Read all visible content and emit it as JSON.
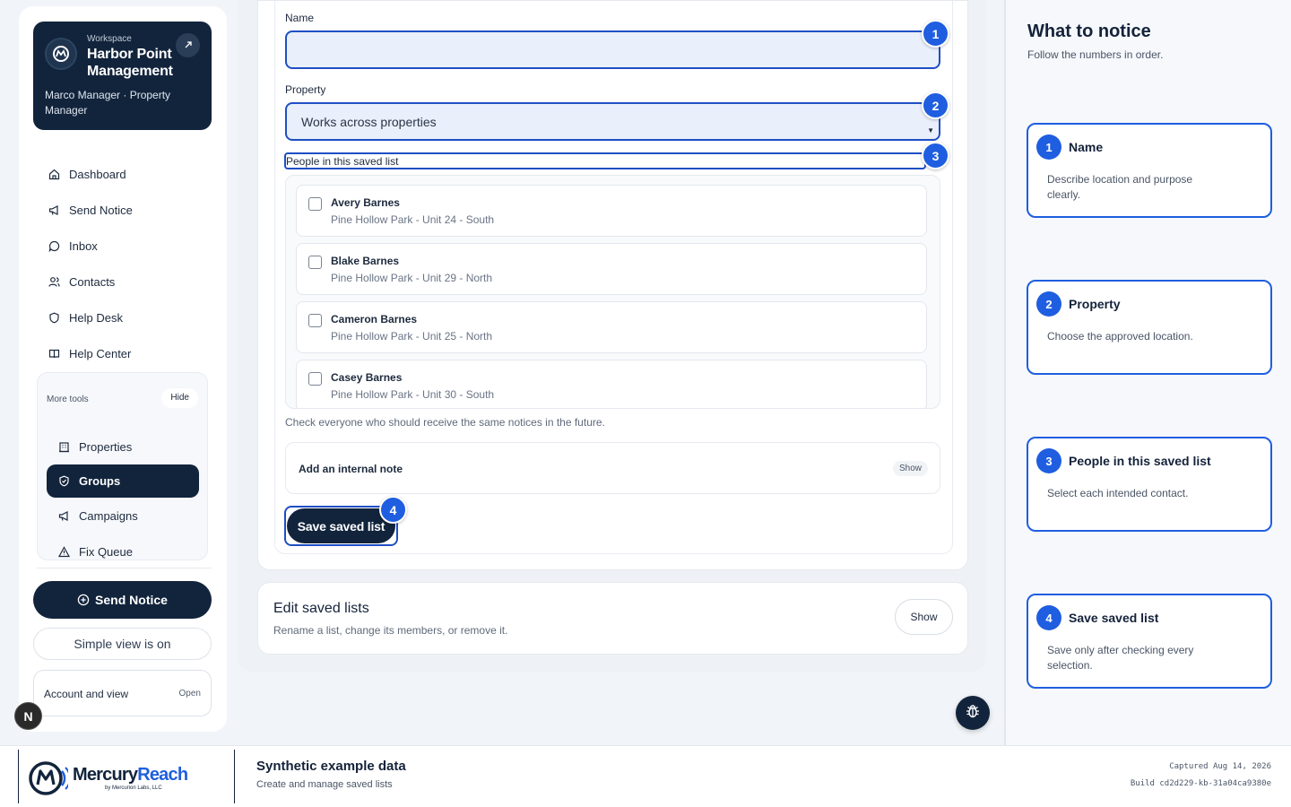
{
  "workspace": {
    "eyebrow": "Workspace",
    "name": "Harbor Point Management",
    "user": "Marco Manager · Property Manager"
  },
  "nav": [
    {
      "label": "Dashboard",
      "icon": "home-icon"
    },
    {
      "label": "Send Notice",
      "icon": "megaphone-icon"
    },
    {
      "label": "Inbox",
      "icon": "chat-icon"
    },
    {
      "label": "Contacts",
      "icon": "users-icon"
    },
    {
      "label": "Help Desk",
      "icon": "shield-icon"
    },
    {
      "label": "Help Center",
      "icon": "book-icon"
    }
  ],
  "more_tools": {
    "heading": "More tools",
    "hide_label": "Hide",
    "items": [
      {
        "label": "Properties",
        "icon": "building-icon"
      },
      {
        "label": "Groups",
        "icon": "shield-icon",
        "active": true
      },
      {
        "label": "Campaigns",
        "icon": "megaphone-icon"
      },
      {
        "label": "Fix Queue",
        "icon": "warning-icon"
      }
    ]
  },
  "send_notice_cta": "Send Notice",
  "simple_view": "Simple view is on",
  "account": {
    "label": "Account and view",
    "open": "Open"
  },
  "dev_badge": "N",
  "form": {
    "name_label": "Name",
    "name_value": "",
    "property_label": "Property",
    "property_value": "Works across properties",
    "people_label": "People in this saved list",
    "people": [
      {
        "name": "Avery Barnes",
        "unit": "Pine Hollow Park - Unit 24 - South",
        "checked": false
      },
      {
        "name": "Blake Barnes",
        "unit": "Pine Hollow Park - Unit 29 - North",
        "checked": false
      },
      {
        "name": "Cameron Barnes",
        "unit": "Pine Hollow Park - Unit 25 - North",
        "checked": false
      },
      {
        "name": "Casey Barnes",
        "unit": "Pine Hollow Park - Unit 30 - South",
        "checked": false
      }
    ],
    "help_text": "Check everyone who should receive the same notices in the future.",
    "note_label": "Add an internal note",
    "note_show": "Show",
    "save_label": "Save saved list"
  },
  "markers": [
    "1",
    "2",
    "3",
    "4"
  ],
  "edit_lists": {
    "title": "Edit saved lists",
    "subtitle": "Rename a list, change its members, or remove it.",
    "show": "Show"
  },
  "guide": {
    "title": "What to notice",
    "subtitle": "Follow the numbers in order.",
    "steps": [
      {
        "num": "1",
        "title": "Name",
        "desc": "Describe location and purpose clearly."
      },
      {
        "num": "2",
        "title": "Property",
        "desc": "Choose the approved location."
      },
      {
        "num": "3",
        "title": "People in this saved list",
        "desc": "Select each intended contact."
      },
      {
        "num": "4",
        "title": "Save saved list",
        "desc": "Save only after checking every selection."
      }
    ]
  },
  "footer": {
    "brand_mercury": "Mercury",
    "brand_reach": "Reach",
    "brand_by": "by Mercurion Labs, LLC",
    "title": "Synthetic example data",
    "subtitle": "Create and manage saved lists",
    "captured": "Captured Aug 14, 2026",
    "build": "Build cd2d229-kb-31a04ca9380e"
  },
  "colors": {
    "navy": "#12243c",
    "accent_blue": "#1f5ee0",
    "focus_outline": "#1f4fc4",
    "input_fill": "#e9effb"
  }
}
